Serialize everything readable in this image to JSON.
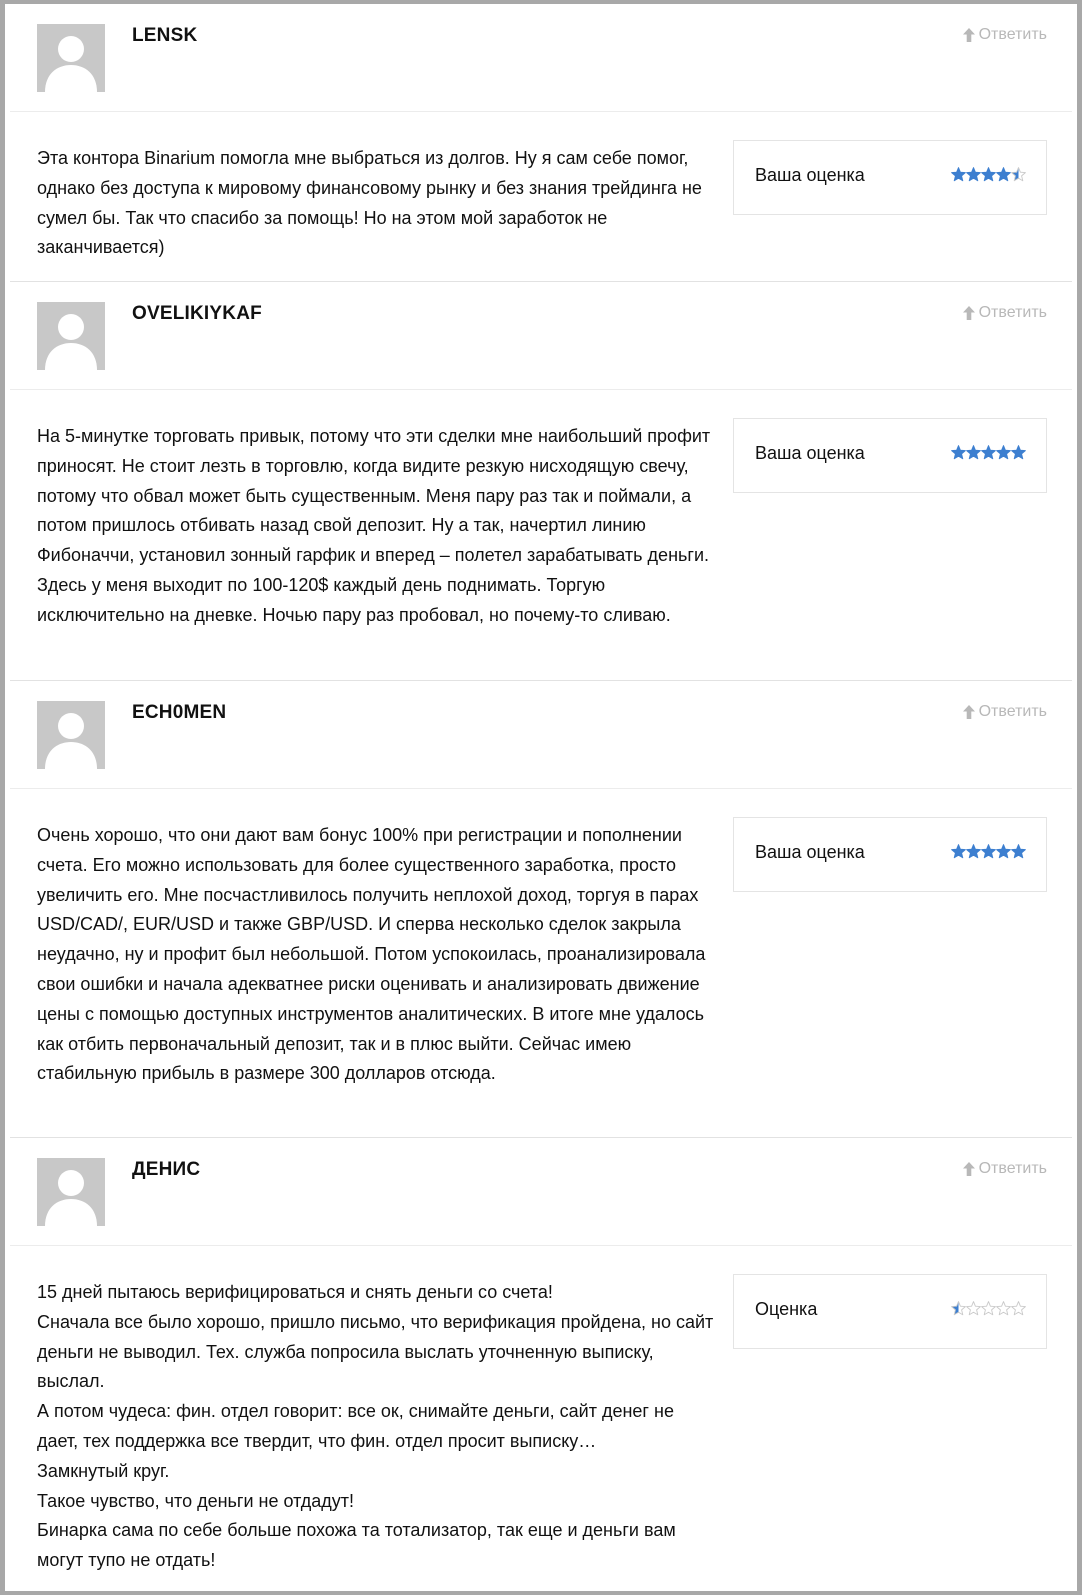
{
  "reply_label": "Ответить",
  "colors": {
    "star_fill": "#3d7fd0",
    "star_empty": "#c9c9c9",
    "reply_text": "#b8b8b8",
    "avatar_bg": "#c8c8c8"
  },
  "reviews": [
    {
      "author": "LENSK",
      "rating_label": "Ваша оценка",
      "rating": 4.5,
      "paragraphs": [
        "Эта контора Binarium помогла мне выбраться из долгов. Ну я сам себе помог, однако без доступа к мировому финансовому рынку и без знания трейдинга не сумел бы. Так что спасибо за помощь! Но на этом мой заработок не заканчивается)"
      ]
    },
    {
      "author": "OVELIKIYKAF",
      "rating_label": "Ваша оценка",
      "rating": 5,
      "paragraphs": [
        "На 5-минутке торговать привык, потому что эти сделки мне наибольший профит приносят. Не стоит лезть в торговлю, когда видите резкую нисходящую свечу, потому что обвал может быть существенным. Меня пару раз так и поймали, а потом пришлось отбивать назад свой депозит. Ну а так, начертил линию Фибоначчи, установил зонный гарфик и вперед – полетел зарабатывать деньги. Здесь у меня выходит по 100-120$ каждый день поднимать. Торгую исключительно на дневке. Ночью пару раз пробовал, но почему-то сливаю."
      ]
    },
    {
      "author": "ECH0MEN",
      "rating_label": "Ваша оценка",
      "rating": 5,
      "paragraphs": [
        "Очень хорошо, что они дают вам бонус 100% при регистрации и пополнении счета. Его можно использовать для более существенного заработка, просто увеличить его. Мне посчастливилось получить неплохой доход, торгуя в парах USD/CAD/, EUR/USD и также GBP/USD. И сперва несколько сделок закрыла неудачно, ну и профит был небольшой. Потом успокоилась, проанализировала свои ошибки и начала адекватнее риски оценивать и анализировать движение цены с помощью доступных инструментов аналитических. В итоге мне удалось как отбить первоначальный депозит, так и в плюс выйти. Сейчас имею стабильную прибыль в размере 300 долларов отсюда."
      ]
    },
    {
      "author": "ДЕНИС",
      "rating_label": "Оценка",
      "rating": 0.5,
      "paragraphs": [
        "15 дней пытаюсь верифицироваться и снять деньги со счета!",
        "Сначала все было хорошо, пришло письмо, что верификация пройдена, но сайт деньги не выводил. Тех. служба попросила выслать уточненную выписку, выслал.",
        "А потом чудеса: фин. отдел говорит: все ок, снимайте деньги, сайт денег не дает, тех поддержка все твердит, что фин. отдел просит выписку…",
        "Замкнутый круг.",
        "Такое чувство, что деньги не отдадут!",
        "Бинарка сама по себе больше похожа та тотализатор, так еще и деньги вам могут тупо не отдать!"
      ]
    }
  ]
}
